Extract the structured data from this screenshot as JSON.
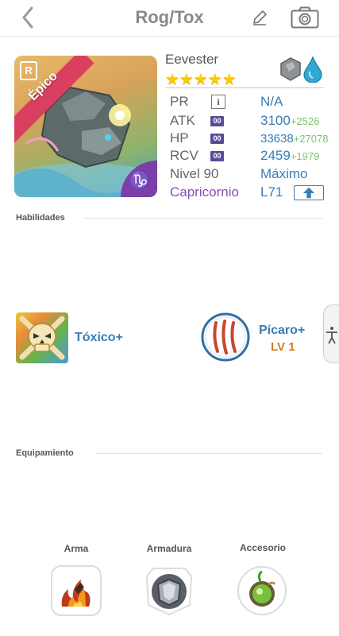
{
  "header": {
    "title": "Rog/Tox"
  },
  "monster": {
    "name": "Eevester",
    "rarity_badge": "R",
    "rarity_ribbon": "Épico",
    "zodiac_symbol": "♑",
    "stars": "★★★★★",
    "star_count": 5,
    "elements": [
      "stone-element-icon",
      "water-element-icon"
    ]
  },
  "stats": {
    "pr": {
      "label": "PR",
      "info": "i",
      "value": "N/A"
    },
    "atk": {
      "label": "ATK",
      "chip": "00",
      "value": "3100",
      "bonus": "+2526"
    },
    "hp": {
      "label": "HP",
      "chip": "00",
      "value": "33638",
      "bonus": "+27078"
    },
    "rcv": {
      "label": "RCV",
      "chip": "00",
      "value": "2459",
      "bonus": "+1979"
    },
    "level": {
      "label": "Nivel 90",
      "value": "Máximo"
    },
    "zodiac": {
      "label": "Capricornio",
      "value": "L71"
    }
  },
  "sections": {
    "skills": "Habilidades",
    "equipment": "Equipamiento"
  },
  "skills": {
    "ability": {
      "name": "Tóxico+",
      "icon": "skull-crossbones-icon"
    },
    "trait": {
      "name": "Pícaro+",
      "level": "LV 1",
      "icon": "claw-marks-icon"
    }
  },
  "equipment": {
    "weapon": {
      "label": "Arma",
      "icon": "flame-weapon-icon"
    },
    "armor": {
      "label": "Armadura",
      "icon": "steel-armor-icon"
    },
    "accessory": {
      "label": "Accesorio",
      "icon": "green-gem-icon"
    }
  },
  "colors": {
    "accent_blue": "#3a7cb5",
    "bonus_green": "#7cc36a",
    "zodiac_purple": "#8a4db8",
    "star_yellow": "#ffcc00",
    "trait_level_orange": "#d9771e",
    "ribbon_red": "#d94060"
  }
}
